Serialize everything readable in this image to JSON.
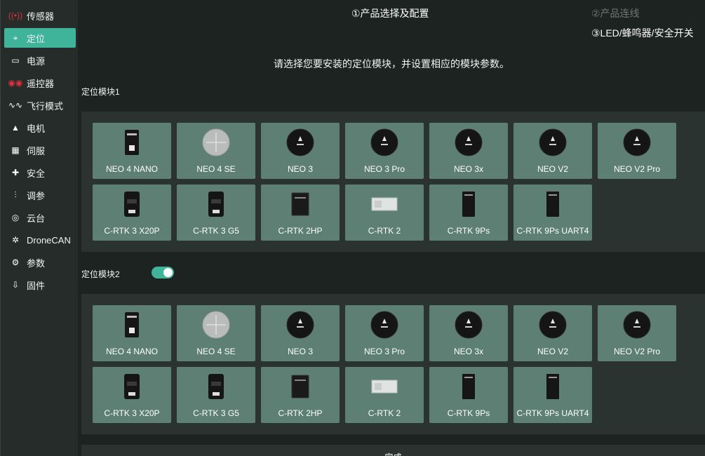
{
  "sidebar": {
    "items": [
      {
        "label": "传感器",
        "icon": "radio-signal-icon",
        "glyph": "((•))",
        "red": true,
        "active": false
      },
      {
        "label": "定位",
        "icon": "location-pin-icon",
        "glyph": "⌖",
        "red": false,
        "active": true
      },
      {
        "label": "电源",
        "icon": "battery-icon",
        "glyph": "▭",
        "red": false,
        "active": false
      },
      {
        "label": "遥控器",
        "icon": "remote-controller-icon",
        "glyph": "◉◉",
        "red": true,
        "active": false
      },
      {
        "label": "飞行模式",
        "icon": "flight-mode-icon",
        "glyph": "∿∿",
        "red": false,
        "active": false
      },
      {
        "label": "电机",
        "icon": "motor-icon",
        "glyph": "▲",
        "red": false,
        "active": false
      },
      {
        "label": "伺服",
        "icon": "servo-icon",
        "glyph": "▦",
        "red": false,
        "active": false
      },
      {
        "label": "安全",
        "icon": "first-aid-icon",
        "glyph": "✚",
        "red": false,
        "active": false
      },
      {
        "label": "调参",
        "icon": "sliders-icon",
        "glyph": "⫶",
        "red": false,
        "active": false
      },
      {
        "label": "云台",
        "icon": "gimbal-icon",
        "glyph": "◎",
        "red": false,
        "active": false
      },
      {
        "label": "DroneCAN",
        "icon": "dronecan-icon",
        "glyph": "✲",
        "red": false,
        "active": false
      },
      {
        "label": "参数",
        "icon": "gears-icon",
        "glyph": "⚙",
        "red": false,
        "active": false
      },
      {
        "label": "固件",
        "icon": "firmware-icon",
        "glyph": "⇩",
        "red": false,
        "active": false
      }
    ]
  },
  "steps": {
    "step1": "①产品选择及配置",
    "step2": "②产品连线",
    "step3": "③LED/蜂鸣器/安全开关"
  },
  "instruction": "请选择您要安装的定位模块，并设置相应的模块参数。",
  "module1": {
    "label": "定位模块1"
  },
  "module2": {
    "label": "定位模块2",
    "enabled": true
  },
  "products": [
    {
      "name": "NEO 4 NANO",
      "icon": "neo4-nano-module-icon",
      "shape": "nano"
    },
    {
      "name": "NEO 4 SE",
      "icon": "neo4-se-module-icon",
      "shape": "se"
    },
    {
      "name": "NEO 3",
      "icon": "neo3-module-icon",
      "shape": "round"
    },
    {
      "name": "NEO 3 Pro",
      "icon": "neo3-pro-module-icon",
      "shape": "round"
    },
    {
      "name": "NEO 3x",
      "icon": "neo3x-module-icon",
      "shape": "round"
    },
    {
      "name": "NEO V2",
      "icon": "neo-v2-module-icon",
      "shape": "round"
    },
    {
      "name": "NEO V2 Pro",
      "icon": "neo-v2-pro-module-icon",
      "shape": "round"
    },
    {
      "name": "C-RTK 3 X20P",
      "icon": "c-rtk3-x20p-module-icon",
      "shape": "rtk3"
    },
    {
      "name": "C-RTK 3 G5",
      "icon": "c-rtk3-g5-module-icon",
      "shape": "rtk3"
    },
    {
      "name": "C-RTK 2HP",
      "icon": "c-rtk2hp-module-icon",
      "shape": "box"
    },
    {
      "name": "C-RTK 2",
      "icon": "c-rtk2-module-icon",
      "shape": "board"
    },
    {
      "name": "C-RTK 9Ps",
      "icon": "c-rtk9ps-module-icon",
      "shape": "tall"
    },
    {
      "name": "C-RTK 9Ps UART4",
      "icon": "c-rtk9ps-uart4-module-icon",
      "shape": "tall"
    }
  ],
  "finish": {
    "label": "完成"
  },
  "colors": {
    "accent": "#3fb49b",
    "card": "#5e7f73",
    "panel": "#2b3330",
    "background": "#1d2321"
  }
}
